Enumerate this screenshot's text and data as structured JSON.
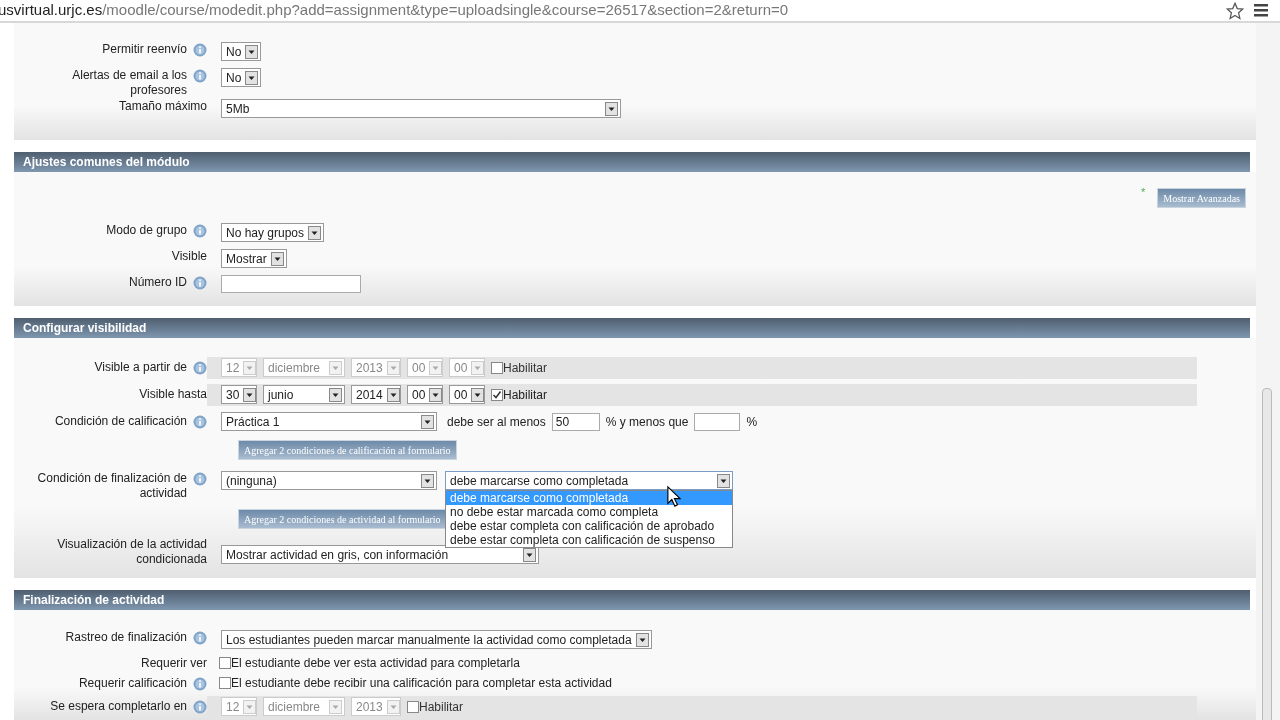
{
  "address_bar": {
    "host": "usvirtual.urjc.es",
    "path": "/moodle/course/modedit.php?add=assignment&type=uploadsingle&course=26517&section=2&return=0"
  },
  "sections": [
    {
      "rows": [
        {
          "kind": "select",
          "label": "Permitir reenvío",
          "help": true,
          "value": "No"
        },
        {
          "kind": "select",
          "label": "Alertas de email a los profesores",
          "help": true,
          "value": "No"
        },
        {
          "kind": "wide-select",
          "label": "Tamaño máximo",
          "help": false,
          "value": "5Mb"
        }
      ]
    },
    {
      "title": "Ajustes comunes del módulo",
      "advanced": {
        "marker": "*",
        "button": "Mostrar Avanzadas"
      },
      "rows": [
        {
          "kind": "select",
          "label": "Modo de grupo",
          "help": true,
          "value": "No hay grupos"
        },
        {
          "kind": "select",
          "label": "Visible",
          "help": false,
          "value": "Mostrar"
        },
        {
          "kind": "text",
          "label": "Número ID",
          "help": true
        }
      ]
    },
    {
      "title": "Configurar visibilidad",
      "rows": [
        {
          "kind": "date",
          "label": "Visible a partir de",
          "help": true,
          "fields": [
            "12",
            "diciembre",
            "2013",
            "00",
            "00"
          ],
          "check_label": "Habilitar",
          "checked": false
        },
        {
          "kind": "date",
          "label": "Visible hasta",
          "help": false,
          "fields": [
            "30",
            "junio",
            "2014",
            "00",
            "00"
          ],
          "check_label": "Habilitar",
          "checked": true
        },
        {
          "kind": "grade",
          "label": "Condición de calificación",
          "help": true,
          "value": "Práctica 1",
          "text_min": "debe ser al menos",
          "min": "50",
          "text_max": "% y menos que",
          "unit": "%"
        },
        {
          "kind": "button",
          "label": "Agregar 2 condiciones de calificación al formulario"
        },
        {
          "kind": "completion",
          "label": "Condición de finalización de actividad",
          "help": true,
          "activity": "(ninguna)",
          "condition": "debe marcarse como completada",
          "expanded": true,
          "options": [
            {
              "label": "debe marcarse como completada",
              "selected": true
            },
            {
              "label": "no debe estar marcada como completa",
              "selected": false
            },
            {
              "label": "debe estar completa con calificación de aprobado",
              "selected": false
            },
            {
              "label": "debe estar completa con calificación de suspenso",
              "selected": false
            }
          ]
        },
        {
          "kind": "button",
          "label": "Agregar 2 condiciones de actividad al formulario"
        },
        {
          "kind": "wide-select",
          "label": "Visualización de la actividad condicionada",
          "help": false,
          "value": "Mostrar actividad en gris, con información"
        }
      ]
    },
    {
      "title": "Finalización de actividad",
      "rows": [
        {
          "kind": "select",
          "label": "Rastreo de finalización",
          "help": true,
          "value": "Los estudiantes pueden marcar manualmente la actividad como completada"
        },
        {
          "kind": "checkbox",
          "label": "Requerir ver",
          "help": false,
          "checked": false,
          "text": "El estudiante debe ver esta actividad para completarla"
        },
        {
          "kind": "checkbox",
          "label": "Requerir calificación",
          "help": true,
          "checked": false,
          "text": "El estudiante debe recibir una calificación para completar esta actividad"
        },
        {
          "kind": "date",
          "label": "Se espera completarlo en",
          "help": true,
          "fields": [
            "12",
            "diciembre",
            "2013"
          ],
          "check_label": "Habilitar",
          "checked": false
        }
      ]
    }
  ]
}
